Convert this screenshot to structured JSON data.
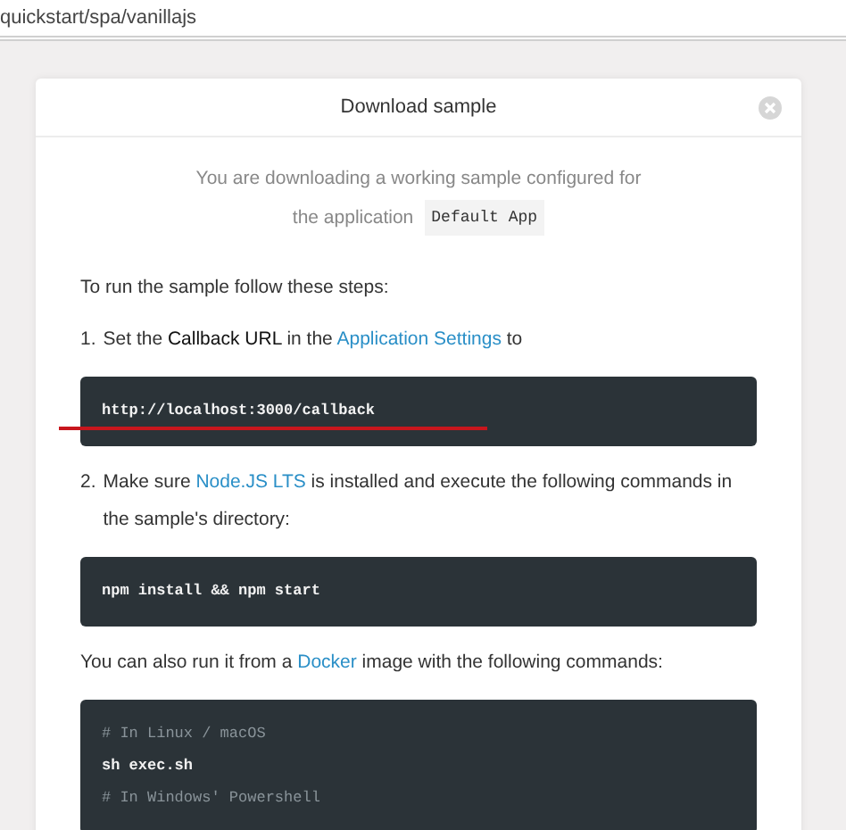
{
  "address_bar": {
    "url": "quickstart/spa/vanillajs"
  },
  "dialog": {
    "title": "Download sample",
    "intro": [
      "You are downloading a working sample configured for",
      {
        "text": "the application",
        "app": "Default App"
      }
    ],
    "lead": "To run the sample follow these steps:",
    "steps": [
      {
        "number": "1.",
        "segments": [
          {
            "kind": "plain",
            "text": "Set the "
          },
          {
            "kind": "bold",
            "text": "Callback URL"
          },
          {
            "kind": "plain",
            "text": " in the "
          },
          {
            "kind": "link",
            "text": "Application Settings"
          },
          {
            "kind": "plain",
            "text": " to"
          }
        ],
        "code": [
          {
            "kind": "command",
            "text": "http://localhost:3000/callback"
          }
        ],
        "underlined": true
      },
      {
        "number": "2.",
        "segments": [
          {
            "kind": "plain",
            "text": "Make sure "
          },
          {
            "kind": "link",
            "text": "Node.JS LTS"
          },
          {
            "kind": "plain",
            "text": " is installed and execute the following commands in the sample's directory:"
          }
        ],
        "code": [
          {
            "kind": "command",
            "text": "npm install && npm start"
          }
        ],
        "underlined": false
      }
    ],
    "docker": {
      "segments": [
        {
          "kind": "plain",
          "text": "You can also run it from a "
        },
        {
          "kind": "link",
          "text": "Docker"
        },
        {
          "kind": "plain",
          "text": " image with the following commands:"
        }
      ],
      "code": [
        {
          "kind": "comment",
          "text": "# In Linux / macOS"
        },
        {
          "kind": "command",
          "text": "sh exec.sh"
        },
        {
          "kind": "comment",
          "text": "# In Windows' Powershell"
        }
      ]
    }
  }
}
